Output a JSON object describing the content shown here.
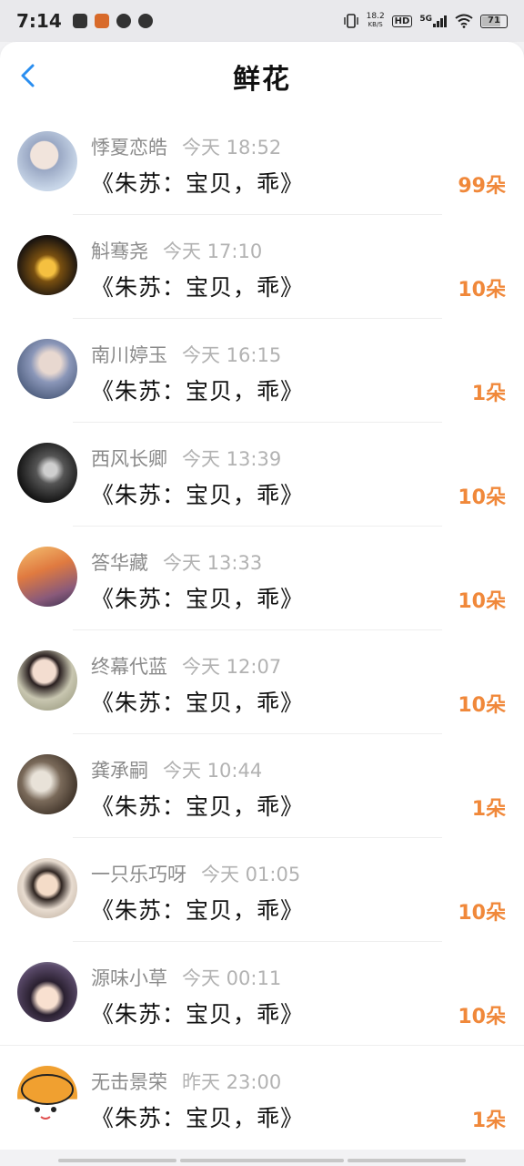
{
  "status_bar": {
    "time": "7:14",
    "net_speed_value": "18.2",
    "net_speed_unit": "KB/S",
    "hd_label": "HD",
    "network": "5G",
    "battery": "71"
  },
  "header": {
    "title": "鲜花"
  },
  "items": [
    {
      "name": "悸夏恋皓",
      "time": "今天 18:52",
      "song": "《朱苏：宝贝，乖》",
      "count": "99朵",
      "avatar_color": "#c8d6e8"
    },
    {
      "name": "斛骞尧",
      "time": "今天 17:10",
      "song": "《朱苏：宝贝，乖》",
      "count": "10朵",
      "avatar_color": "#3a2a10"
    },
    {
      "name": "南川婷玉",
      "time": "今天 16:15",
      "song": "《朱苏：宝贝，乖》",
      "count": "1朵",
      "avatar_color": "#6a7a9a"
    },
    {
      "name": "西风长卿",
      "time": "今天 13:39",
      "song": "《朱苏：宝贝，乖》",
      "count": "10朵",
      "avatar_color": "#2a2a2a"
    },
    {
      "name": "答华藏",
      "time": "今天 13:33",
      "song": "《朱苏：宝贝，乖》",
      "count": "10朵",
      "avatar_color": "#d8904a"
    },
    {
      "name": "终幕代蓝",
      "time": "今天 12:07",
      "song": "《朱苏：宝贝，乖》",
      "count": "10朵",
      "avatar_color": "#b8b6a0"
    },
    {
      "name": "龚承嗣",
      "time": "今天 10:44",
      "song": "《朱苏：宝贝，乖》",
      "count": "1朵",
      "avatar_color": "#5a4a3a"
    },
    {
      "name": "一只乐巧呀",
      "time": "今天 01:05",
      "song": "《朱苏：宝贝，乖》",
      "count": "10朵",
      "avatar_color": "#d8c0b0"
    },
    {
      "name": "源味小草",
      "time": "今天 00:11",
      "song": "《朱苏：宝贝，乖》",
      "count": "10朵",
      "avatar_color": "#3a3040"
    },
    {
      "name": "无击景荣",
      "time": "昨天 23:00",
      "song": "《朱苏：宝贝，乖》",
      "count": "1朵",
      "avatar_color": "#f0a030"
    }
  ],
  "colors": {
    "accent_count": "#f0883a",
    "back_arrow": "#2a8ef0"
  }
}
